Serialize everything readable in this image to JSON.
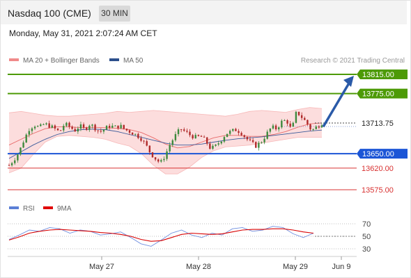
{
  "header": {
    "title": "Nasdaq 100 (CME)",
    "timeframe": "30 MIN"
  },
  "timestamp": "Monday, May 31, 2021 2:07:24 AM CET",
  "legend": [
    {
      "label": "MA 20 + Bollinger Bands",
      "color": "#f08a8a"
    },
    {
      "label": "MA 50",
      "color": "#2c4f8c"
    }
  ],
  "credit": "Research © 2021 Trading Central",
  "rsi_legend": [
    {
      "label": "RSI",
      "color": "#5b7fd6"
    },
    {
      "label": "9MA",
      "color": "#e00000"
    }
  ],
  "chart_data": {
    "type": "candlestick",
    "x_ticks": [
      "May 27",
      "May 28",
      "May 29",
      "Jun 9"
    ],
    "levels": [
      {
        "value": 13815.0,
        "label": "13815.00",
        "kind": "target",
        "color": "#4d9a06"
      },
      {
        "value": 13775.0,
        "label": "13775.00",
        "kind": "target",
        "color": "#4d9a06"
      },
      {
        "value": 13713.75,
        "label": "13713.75",
        "kind": "last",
        "color": "#333333"
      },
      {
        "value": 13650.0,
        "label": "13650.00",
        "kind": "pivot",
        "color": "#1b55d6"
      },
      {
        "value": 13620.0,
        "label": "13620.00",
        "kind": "support",
        "color": "#d83030"
      },
      {
        "value": 13575.0,
        "label": "13575.00",
        "kind": "support",
        "color": "#d83030"
      }
    ],
    "price_path": [
      13626,
      13638,
      13654,
      13680,
      13702,
      13710,
      13704,
      13712,
      13708,
      13702,
      13695,
      13712,
      13706,
      13698,
      13708,
      13700,
      13712,
      13704,
      13695,
      13702,
      13708,
      13705,
      13708,
      13700,
      13696,
      13690,
      13684,
      13670,
      13652,
      13640,
      13630,
      13648,
      13672,
      13688,
      13702,
      13695,
      13688,
      13684,
      13686,
      13676,
      13660,
      13666,
      13678,
      13692,
      13696,
      13700,
      13694,
      13682,
      13672,
      13666,
      13675,
      13690,
      13705,
      13702,
      13716,
      13720,
      13698,
      13738,
      13726,
      13714,
      13698,
      13706,
      13714
    ],
    "bollinger": {
      "upper": [
        13735,
        13738,
        13734,
        13730,
        13728,
        13728,
        13730,
        13732,
        13734,
        13738,
        13736,
        13738,
        13740,
        13738,
        13736,
        13734,
        13732,
        13730,
        13728,
        13732,
        13738,
        13740,
        13738,
        13736,
        13742,
        13746,
        13744
      ],
      "middle": [
        13668,
        13680,
        13692,
        13702,
        13706,
        13706,
        13704,
        13705,
        13704,
        13703,
        13700,
        13694,
        13683,
        13670,
        13662,
        13665,
        13674,
        13683,
        13688,
        13688,
        13686,
        13686,
        13690,
        13696,
        13705,
        13712,
        13714
      ],
      "lower": [
        13610,
        13620,
        13648,
        13674,
        13686,
        13688,
        13686,
        13684,
        13680,
        13672,
        13666,
        13650,
        13626,
        13608,
        13608,
        13622,
        13642,
        13656,
        13664,
        13666,
        13668,
        13672,
        13676,
        13680,
        13684,
        13684,
        13684
      ]
    },
    "ma50": [
      13640,
      13654,
      13668,
      13680,
      13690,
      13696,
      13700,
      13701,
      13700,
      13696,
      13690,
      13684,
      13678,
      13672,
      13668,
      13668,
      13670,
      13674,
      13678,
      13681,
      13683,
      13685,
      13688,
      13691,
      13694,
      13697,
      13699
    ],
    "projection": {
      "from": 13706,
      "to": 13815
    },
    "rsi": {
      "ticks": [
        70,
        50,
        30
      ],
      "rsi_values": [
        45,
        52,
        60,
        58,
        64,
        62,
        55,
        60,
        58,
        52,
        54,
        57,
        48,
        38,
        34,
        44,
        55,
        60,
        52,
        48,
        55,
        52,
        62,
        64,
        58,
        60,
        66,
        64,
        54,
        48,
        55
      ],
      "ma_values": [
        44,
        49,
        55,
        58,
        60,
        61,
        60,
        59,
        58,
        56,
        55,
        53,
        50,
        45,
        42,
        43,
        48,
        53,
        55,
        54,
        53,
        54,
        57,
        60,
        61,
        61,
        62,
        62,
        60,
        57,
        55
      ]
    }
  }
}
